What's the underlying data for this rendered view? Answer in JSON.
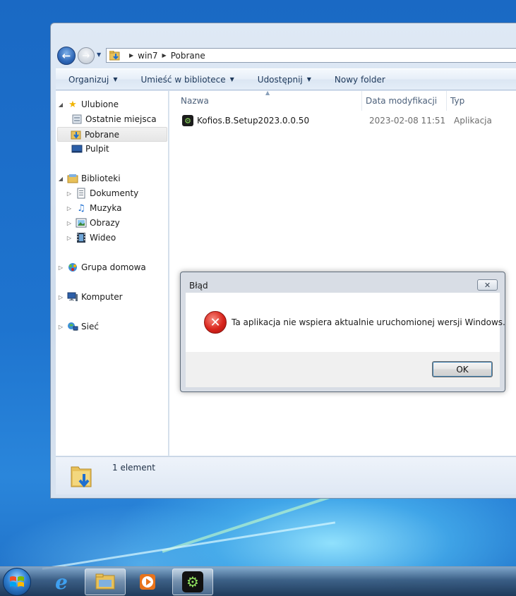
{
  "explorer": {
    "breadcrumb": [
      "win7",
      "Pobrane"
    ],
    "toolbar": {
      "organize": "Organizuj",
      "include_library": "Umieść w bibliotece",
      "share": "Udostępnij",
      "new_folder": "Nowy folder"
    },
    "nav": {
      "favorites": "Ulubione",
      "recent": "Ostatnie miejsca",
      "downloads": "Pobrane",
      "desktop": "Pulpit",
      "libraries": "Biblioteki",
      "documents": "Dokumenty",
      "music": "Muzyka",
      "pictures": "Obrazy",
      "videos": "Wideo",
      "homegroup": "Grupa domowa",
      "computer": "Komputer",
      "network": "Sieć"
    },
    "columns": {
      "name": "Nazwa",
      "modified": "Data modyfikacji",
      "type": "Typ"
    },
    "files": [
      {
        "name": "Kofios.B.Setup2023.0.0.50",
        "modified": "2023-02-08 11:51",
        "type": "Aplikacja"
      }
    ],
    "details": {
      "count": "1 element"
    }
  },
  "dialog": {
    "title": "Błąd",
    "close_symbol": "✕",
    "message": "Ta aplikacja nie wspiera aktualnie uruchomionej wersji Windows.",
    "ok_label": "OK"
  },
  "colors": {
    "selection": "#e6e6e6",
    "error_red": "#d9251c",
    "link_text": "#1e395b"
  }
}
